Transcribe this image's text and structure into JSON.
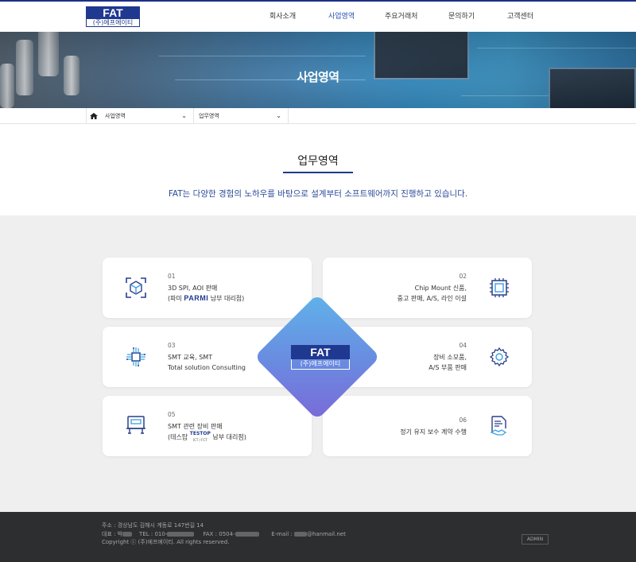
{
  "header": {
    "logo_title": "FAT",
    "logo_sub": "(주)에프에이티",
    "nav": [
      "회사소개",
      "사업영역",
      "주요거래처",
      "문의하기",
      "고객센터"
    ],
    "active_nav": "사업영역"
  },
  "banner": {
    "title": "사업영역"
  },
  "breadcrumb": {
    "home_icon": "home-icon",
    "level1": "사업영역",
    "level2": "업무영역"
  },
  "intro": {
    "title": "업무영역",
    "description": "FAT는 다양한 경험의 노하우를 바탕으로 설계부터 소프트웨어까지 진행하고 있습니다."
  },
  "services": [
    {
      "num": "01",
      "line1": "3D SPI, AOI 판매",
      "line2_pre": "(파미 ",
      "line2_brand": "PARMI",
      "line2_post": " 남부 대리점)",
      "icon": "cube-scan-icon"
    },
    {
      "num": "02",
      "line1": "Chip Mount 신품,",
      "line2": "중고 판매, A/S, 라인 이설",
      "icon": "chip-icon"
    },
    {
      "num": "03",
      "line1": "SMT 교육, SMT",
      "line2": "Total solution Consulting",
      "icon": "circuit-icon"
    },
    {
      "num": "04",
      "line1": "장비 소모품,",
      "line2": "A/S 부품 판매",
      "icon": "gear-icon"
    },
    {
      "num": "05",
      "line1": "SMT 관련 장비 판매",
      "line2_pre": "(테스탑 ",
      "line2_brand": "TESTOP",
      "line2_brand_sub": "ICT / FCT",
      "line2_post": " 남부 대리점)",
      "icon": "machine-icon"
    },
    {
      "num": "06",
      "line1": "정기 유지 보수 계약 수행",
      "icon": "contract-handshake-icon"
    }
  ],
  "center_logo": {
    "title": "FAT",
    "sub": "(주)에프에이티"
  },
  "footer": {
    "address": "주소 : 경상남도 김해시 계동로 147번길 14",
    "rep_label": "대표 : 박",
    "tel_label": "TEL : 010-",
    "fax_label": "FAX : 0504-",
    "email_label": "E-mail : ",
    "email_domain": "@hanmail.net",
    "copyright": "Copyright ⓒ (주)에프에이티. All rights reserved.",
    "admin": "ADMIN"
  },
  "colors": {
    "brand": "#1f3890",
    "accent_text": "#2a4a9a",
    "footer_bg": "#2d2e30"
  }
}
